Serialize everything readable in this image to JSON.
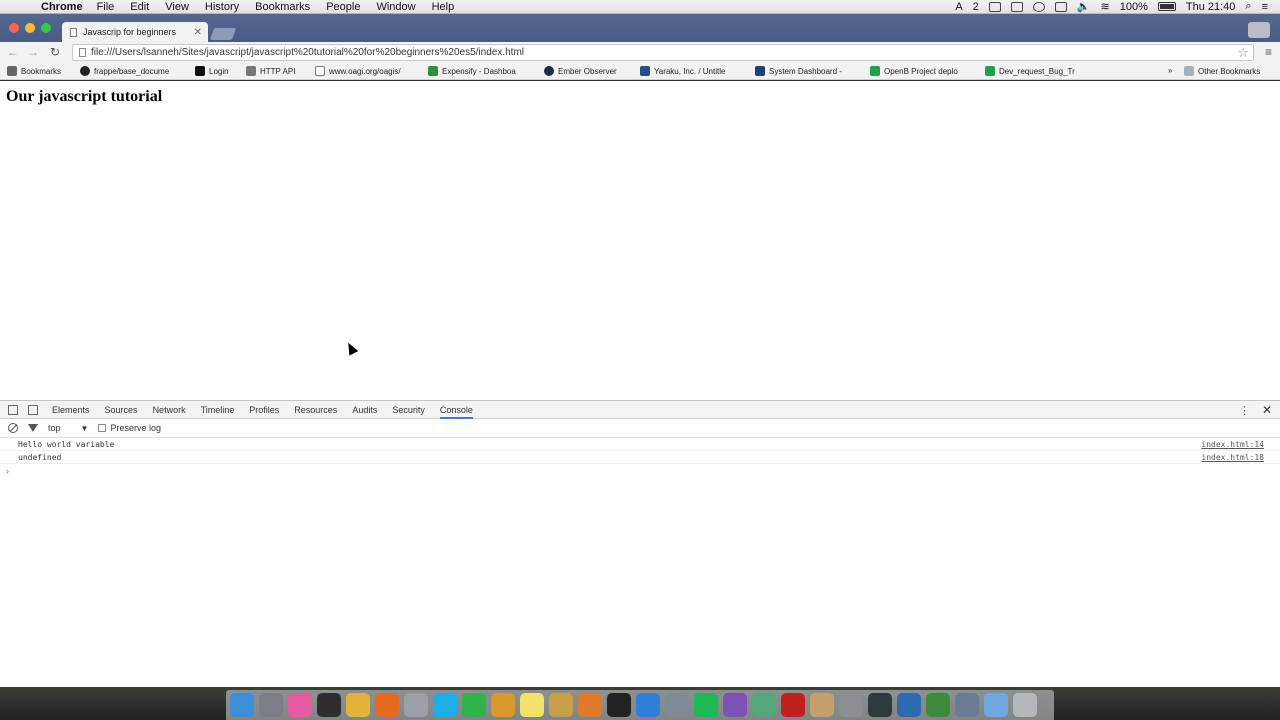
{
  "menubar": {
    "app_name": "Chrome",
    "items": [
      "File",
      "Edit",
      "View",
      "History",
      "Bookmarks",
      "People",
      "Window",
      "Help"
    ],
    "status": {
      "badge_count": "2",
      "battery": "100%",
      "clock": "Thu 21:40"
    }
  },
  "tab": {
    "title": "Javascrip for beginners"
  },
  "toolbar": {
    "url": "file:///Users/lsanneh/Sites/javascript/javascript%20tutorial%20for%20beginners%20es5/index.html"
  },
  "bookmarks": {
    "items": [
      "Bookmarks",
      "frappe/base_docume",
      "Login",
      "HTTP API",
      "www.oagi.org/oagis/",
      "Expensify - Dashboa",
      "Ember Observer",
      "Yaraku, Inc. / Untitle",
      "System Dashboard -",
      "OpenB Project deplo",
      "Dev_request_Bug_Tr"
    ],
    "overflow": "»",
    "other": "Other Bookmarks"
  },
  "page": {
    "heading": "Our javascript tutorial"
  },
  "devtools": {
    "tabs": [
      "Elements",
      "Sources",
      "Network",
      "Timeline",
      "Profiles",
      "Resources",
      "Audits",
      "Security",
      "Console"
    ],
    "active_tab": "Console",
    "context": "top",
    "preserve_log": "Preserve log",
    "logs": [
      {
        "message": "Hello world variable",
        "source": "index.html:14"
      },
      {
        "message": "undefined",
        "source": "index.html:18"
      }
    ],
    "prompt": "›"
  },
  "dock": {
    "icons": [
      "finder-icon",
      "launchpad-icon",
      "itunes-icon",
      "activity-monitor-icon",
      "chrome-icon",
      "firefox-icon",
      "calculator-icon",
      "skype-icon",
      "evernote-icon",
      "sequel-pro-icon",
      "notes-icon",
      "dbase-icon",
      "sublime-icon",
      "terminal-icon",
      "app-store-icon",
      "preview-icon",
      "spotify-icon",
      "viber-icon",
      "atom-icon",
      "filezilla-icon",
      "pages-icon",
      "database-icon",
      "gitkraken-icon",
      "sourcetree-icon",
      "vpn-icon",
      "finder-window-icon",
      "downloads-icon",
      "trash-icon"
    ],
    "colors": [
      "#3b8fd9",
      "#7a7f86",
      "#e55aa0",
      "#2e2e2e",
      "#e2b33a",
      "#e46a1f",
      "#9aa0a6",
      "#1eaee7",
      "#2fb34a",
      "#d89a2d",
      "#f3e36a",
      "#c9a04a",
      "#e07a2b",
      "#222222",
      "#2f7fd8",
      "#7e8a96",
      "#1db954",
      "#7d52b5",
      "#53a77b",
      "#c2201d",
      "#c4a06a",
      "#8a8f94",
      "#2f3a3d",
      "#2d6bb0",
      "#3c8a3c",
      "#6a7c93",
      "#6fa9e0",
      "#b5b8bb"
    ]
  }
}
